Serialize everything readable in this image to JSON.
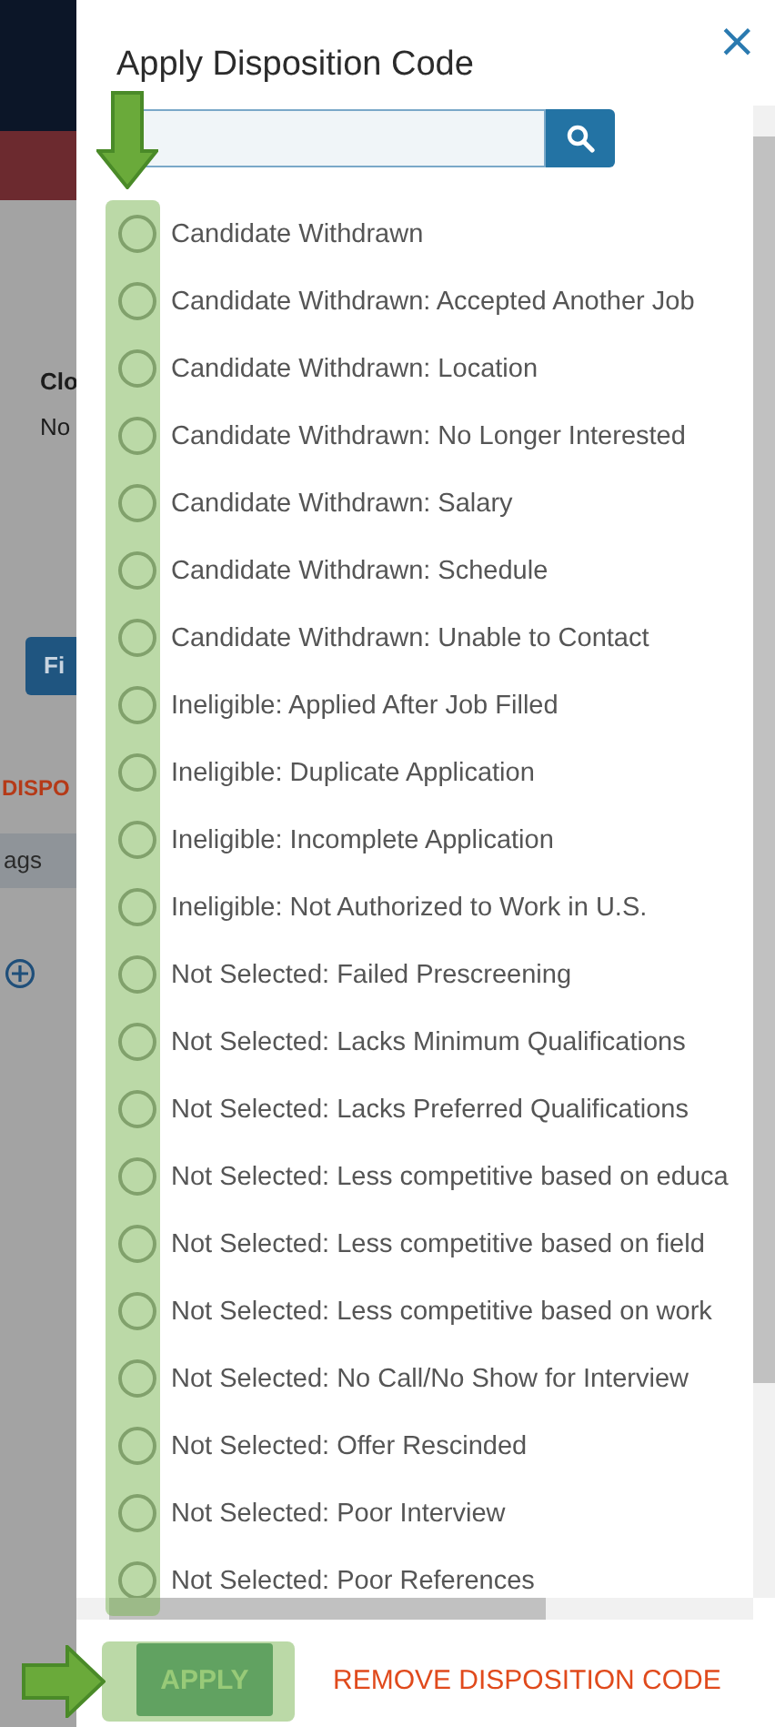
{
  "background_page": {
    "texts": [
      {
        "kind": "heading",
        "text": "Clo"
      },
      {
        "kind": "value",
        "text": "No"
      },
      {
        "kind": "button",
        "text": "Fi"
      },
      {
        "kind": "link",
        "text": "DISPO"
      },
      {
        "kind": "band",
        "text": "ags"
      }
    ]
  },
  "dialog": {
    "title": "Apply Disposition Code",
    "close": "×",
    "options": [
      {
        "label": "Candidate Withdrawn",
        "selected": false
      },
      {
        "label": "Candidate Withdrawn: Accepted Another Job",
        "selected": false
      },
      {
        "label": "Candidate Withdrawn: Location",
        "selected": false
      },
      {
        "label": "Candidate Withdrawn: No Longer Interested",
        "selected": false
      },
      {
        "label": "Candidate Withdrawn: Salary",
        "selected": false
      },
      {
        "label": "Candidate Withdrawn: Schedule",
        "selected": false
      },
      {
        "label": "Candidate Withdrawn: Unable to Contact",
        "selected": false
      },
      {
        "label": "Ineligible: Applied After Job Filled",
        "selected": false
      },
      {
        "label": "Ineligible: Duplicate Application",
        "selected": false
      },
      {
        "label": "Ineligible: Incomplete Application",
        "selected": false
      },
      {
        "label": "Ineligible: Not Authorized to Work in U.S.",
        "selected": false
      },
      {
        "label": "Not Selected: Failed Prescreening",
        "selected": false
      },
      {
        "label": "Not Selected: Lacks Minimum Qualifications",
        "selected": false
      },
      {
        "label": "Not Selected: Lacks Preferred Qualifications",
        "selected": false
      },
      {
        "label": "Not Selected: Less competitive based on educa",
        "selected": false
      },
      {
        "label": "Not Selected: Less competitive based on field",
        "selected": false
      },
      {
        "label": "Not Selected: Less competitive based on work",
        "selected": false
      },
      {
        "label": "Not Selected: No Call/No Show for Interview",
        "selected": false
      },
      {
        "label": "Not Selected: Offer Rescinded",
        "selected": false
      },
      {
        "label": "Not Selected: Poor Interview",
        "selected": false
      },
      {
        "label": "Not Selected: Poor References",
        "selected": false
      }
    ],
    "buttons": [
      {
        "kind": "primary",
        "label": "APPLY"
      },
      {
        "kind": "link",
        "label": "REMOVE DISPOSITION CODE"
      }
    ]
  }
}
